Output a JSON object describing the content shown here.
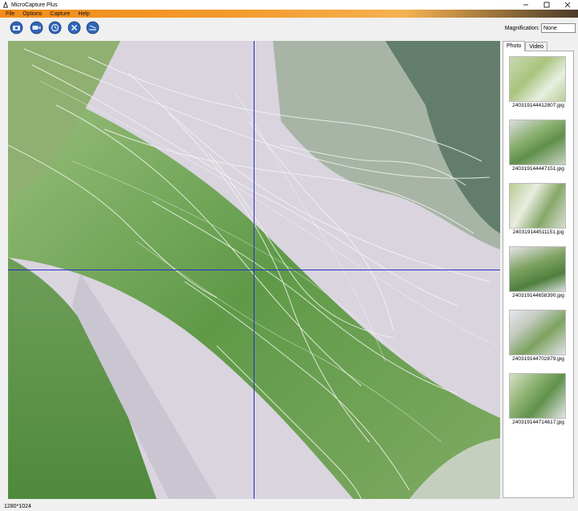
{
  "titlebar": {
    "title": "MicroCapture Plus"
  },
  "menu": [
    {
      "label": "File"
    },
    {
      "label": "Options"
    },
    {
      "label": "Capture"
    },
    {
      "label": "Help"
    }
  ],
  "toolbar": {
    "buttons": [
      {
        "icon": "camera-snapshot-icon"
      },
      {
        "icon": "video-camera-icon"
      },
      {
        "icon": "timer-icon"
      },
      {
        "icon": "settings-icon"
      },
      {
        "icon": "measure-icon"
      }
    ],
    "magnification_label": "Magnification:",
    "magnification_value": "None"
  },
  "sidepanel": {
    "tabs": [
      {
        "label": "Photo",
        "active": true
      },
      {
        "label": "Video",
        "active": false
      }
    ],
    "thumbnails": [
      {
        "name": "240319144412807.jpg"
      },
      {
        "name": "240319144447151.jpg"
      },
      {
        "name": "240319144511151.jpg"
      },
      {
        "name": "240319144658390.jpg"
      },
      {
        "name": "240319144702879.jpg"
      },
      {
        "name": "240319144714617.jpg"
      }
    ]
  },
  "status": {
    "resolution": "1280*1024"
  },
  "colors": {
    "menubar_start": "#f28c1a",
    "crosshair": "#2a2ad0"
  }
}
